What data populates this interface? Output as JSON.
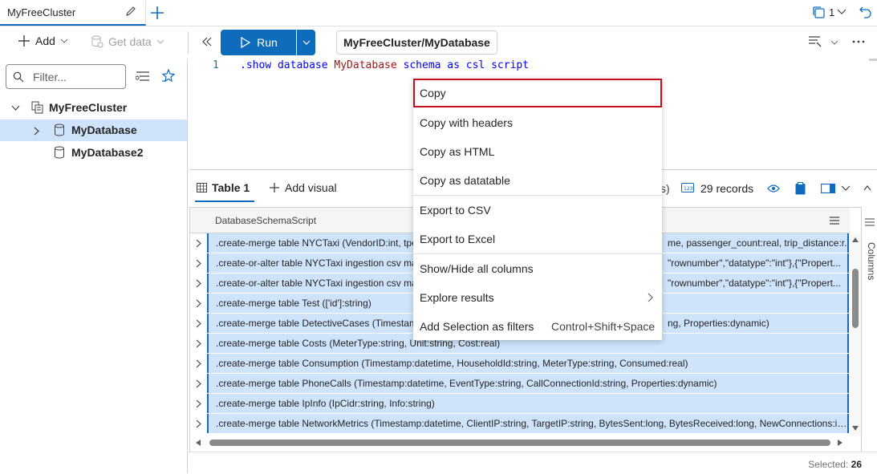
{
  "tab": {
    "title": "MyFreeCluster",
    "count": "1"
  },
  "toolbar": {
    "add_label": "Add",
    "get_data_label": "Get data",
    "run_label": "Run",
    "scope": "MyFreeCluster/MyDatabase"
  },
  "sidebar": {
    "filter_placeholder": "Filter...",
    "tree": {
      "cluster": "MyFreeCluster",
      "databases": [
        "MyDatabase",
        "MyDatabase2"
      ]
    }
  },
  "editor": {
    "line_number": "1",
    "tokens": [
      ".show database",
      "MyDatabase",
      "schema as csl script"
    ]
  },
  "results": {
    "tab_label": "Table 1",
    "add_visual_label": "Add visual",
    "partial_text": "s)",
    "records_label": "29 records",
    "column_header": "DatabaseSchemaScript",
    "columns_panel_label": "Columns",
    "selected_label": "Selected:",
    "selected_count": "26",
    "rows": [
      {
        "left": ".create-merge table NYCTaxi (VendorID:int, tpep",
        "right": "me, passenger_count:real, trip_distance:r..."
      },
      {
        "left": ".create-or-alter table NYCTaxi ingestion csv ma",
        "right": "\"rownumber\",\"datatype\":\"int\"},{\"Propert..."
      },
      {
        "left": ".create-or-alter table NYCTaxi ingestion csv ma",
        "right": "\"rownumber\",\"datatype\":\"int\"},{\"Propert..."
      },
      {
        "left": ".create-merge table Test (['id']:string)",
        "right": ""
      },
      {
        "left": ".create-merge table DetectiveCases (Timestam",
        "right": "ng, Properties:dynamic)"
      },
      {
        "left": ".create-merge table Costs (MeterType:string, Unit:string, Cost:real)",
        "right": ""
      },
      {
        "left": ".create-merge table Consumption (Timestamp:datetime, HouseholdId:string, MeterType:string, Consumed:real)",
        "right": ""
      },
      {
        "left": ".create-merge table PhoneCalls (Timestamp:datetime, EventType:string, CallConnectionId:string, Properties:dynamic)",
        "right": ""
      },
      {
        "left": ".create-merge table IpInfo (IpCidr:string, Info:string)",
        "right": ""
      },
      {
        "left": ".create-merge table NetworkMetrics (Timestamp:datetime, ClientIP:string, TargetIP:string, BytesSent:long, BytesReceived:long, NewConnections:int)",
        "right": ""
      }
    ]
  },
  "context_menu": {
    "items": [
      {
        "label": "Copy",
        "shortcut": ""
      },
      {
        "label": "Copy with headers",
        "shortcut": ""
      },
      {
        "label": "Copy as HTML",
        "shortcut": ""
      },
      {
        "label": "Copy as datatable",
        "shortcut": ""
      },
      {
        "label": "Export to CSV",
        "shortcut": ""
      },
      {
        "label": "Export to Excel",
        "shortcut": ""
      },
      {
        "label": "Show/Hide all columns",
        "shortcut": ""
      },
      {
        "label": "Explore results",
        "shortcut": ""
      },
      {
        "label": "Add Selection as filters",
        "shortcut": "Control+Shift+Space"
      }
    ]
  },
  "colors": {
    "accent": "#0f6cbd",
    "selection": "#cfe4fa",
    "highlight_border": "#c50f1f",
    "keyword": "#0000ff",
    "entity": "#a31515"
  }
}
